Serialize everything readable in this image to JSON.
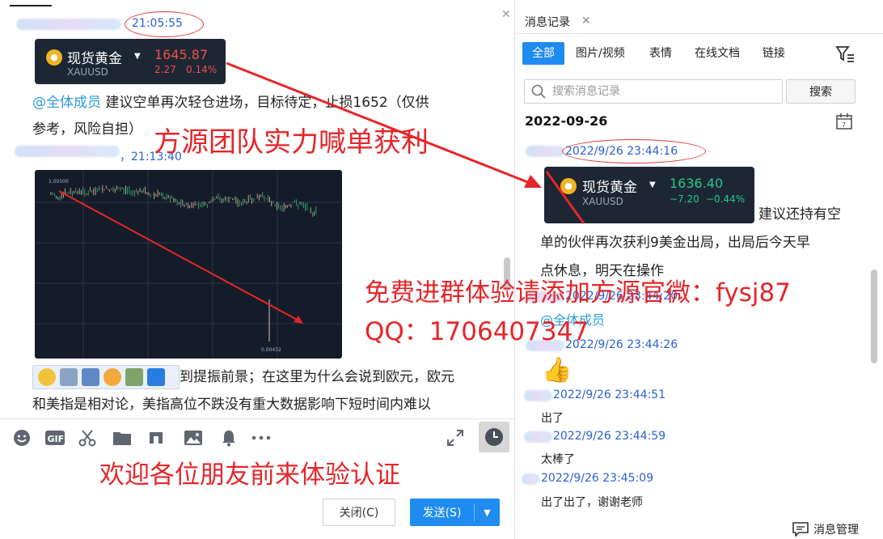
{
  "chat": {
    "msg1_time": "21:05:55",
    "gold_card_1": {
      "name": "现货黄金",
      "symbol": "XAUUSD",
      "price": "1645.87",
      "change": "2.27",
      "change_pct": "0.14%"
    },
    "msg1_mention": "@全体成员",
    "msg1_text_line1": " 建议空单再次轻仓进场，目标待定，止损1652（仅供",
    "msg1_text_line2": "参考，风险自担）",
    "msg2_time": "，21:13:40",
    "chart_labels": {
      "top_left": "1.00500",
      "bottom": "0.00432"
    },
    "msg3_line1": "到提振前景；在这里为什么会说到欧元，欧元",
    "msg3_line2": "和美指是相对论，美指高位不跌没有重大数据影响下短时间内难以"
  },
  "promo": {
    "team_call": "方源团队实力喊单获利",
    "free_join": "免费进群体验请添加方源官微：fysj87",
    "qq": "QQ：1706407347",
    "welcome": "欢迎各位朋友前来体验认证"
  },
  "composer": {
    "close_label": "关闭(C)",
    "send_label": "发送(S)"
  },
  "history": {
    "title": "消息记录",
    "tabs": [
      "全部",
      "图片/视频",
      "表情",
      "在线文档",
      "链接"
    ],
    "search_placeholder": "搜索消息记录",
    "search_button": "搜索",
    "date": "2022-09-26",
    "entries": {
      "t1": "2022/9/26 23:44:16",
      "gold_card_2": {
        "name": "现货黄金",
        "symbol": "XAUUSD",
        "price": "1636.40",
        "change": "−7.20",
        "change_pct": "−0.44%"
      },
      "text1_tail": "建议还持有空",
      "text1_line2": "单的伙伴再次获利9美金出局，出局后今天早",
      "text1_line3": "点休息，明天在操作",
      "t2": "2022/9/26 23:44:20",
      "mention": "@全体成员",
      "t3": "2022/9/26 23:44:26",
      "t4": "2022/9/26 23:44:51",
      "text4": "出了",
      "t5": "2022/9/26 23:44:59",
      "text5": "太棒了",
      "t6": "2022/9/26 23:45:09",
      "text6": "出了出了，谢谢老师"
    },
    "manage_label": "消息管理"
  },
  "colors": {
    "accent_blue": "#1e8cf0",
    "timestamp_blue": "#2a5fd6",
    "mention_blue": "#2a9cde",
    "price_up_red": "#f04d4d",
    "price_down_green": "#1fc88a",
    "promo_red": "#e5262a",
    "card_bg": "#1d2734"
  },
  "icons": [
    "emoji-icon",
    "gif-icon",
    "scissors-icon",
    "folder-icon",
    "music-icon",
    "image-icon",
    "bell-icon",
    "more-icon",
    "expand-icon",
    "clock-icon",
    "search-icon",
    "filter-icon",
    "calendar-icon",
    "message-manage-icon",
    "gold-coin-icon"
  ]
}
